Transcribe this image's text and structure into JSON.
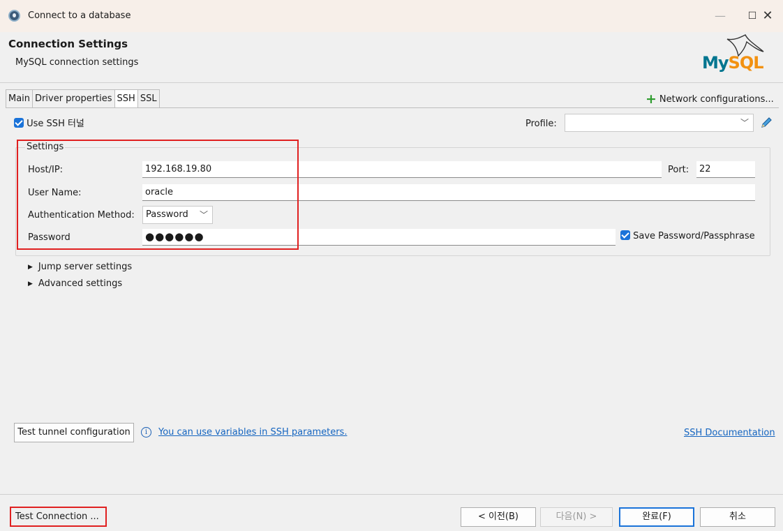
{
  "window": {
    "title": "Connect to a database",
    "minimize": "—",
    "maximize": "☐",
    "close": "✕"
  },
  "header": {
    "title": "Connection Settings",
    "subtitle": "MySQL connection settings",
    "logo_text_my": "My",
    "logo_text_sql": "SQL"
  },
  "tabs": [
    {
      "label": "Main"
    },
    {
      "label": "Driver properties"
    },
    {
      "label": "SSH"
    },
    {
      "label": "SSL"
    }
  ],
  "active_tab": "SSH",
  "network_configurations": "Network configurations...",
  "ssh": {
    "use_ssh_label": "Use SSH 터널",
    "use_ssh_checked": true,
    "profile_label": "Profile:",
    "profile_value": "",
    "settings_legend": "Settings",
    "host_label": "Host/IP:",
    "host_value": "192.168.19.80",
    "port_label": "Port:",
    "port_value": "22",
    "user_label": "User Name:",
    "user_value": "oracle",
    "auth_label": "Authentication Method:",
    "auth_value": "Password",
    "password_label": "Password",
    "password_value": "●●●●●●",
    "save_password_label": "Save Password/Passphrase",
    "save_password_checked": true,
    "jump_server": "Jump server settings",
    "advanced": "Advanced settings",
    "test_tunnel": "Test tunnel configuration",
    "variables_link": "You can use variables in SSH parameters.",
    "documentation_link": "SSH Documentation"
  },
  "footer": {
    "test_connection": "Test Connection ...",
    "back": "< 이전(B)",
    "next": "다음(N) >",
    "finish": "완료(F)",
    "cancel": "취소"
  },
  "colors": {
    "accent": "#1a73d9",
    "link": "#1565c0",
    "highlight": "#e02020",
    "mysql_blue": "#00758f",
    "mysql_orange": "#f29111"
  }
}
